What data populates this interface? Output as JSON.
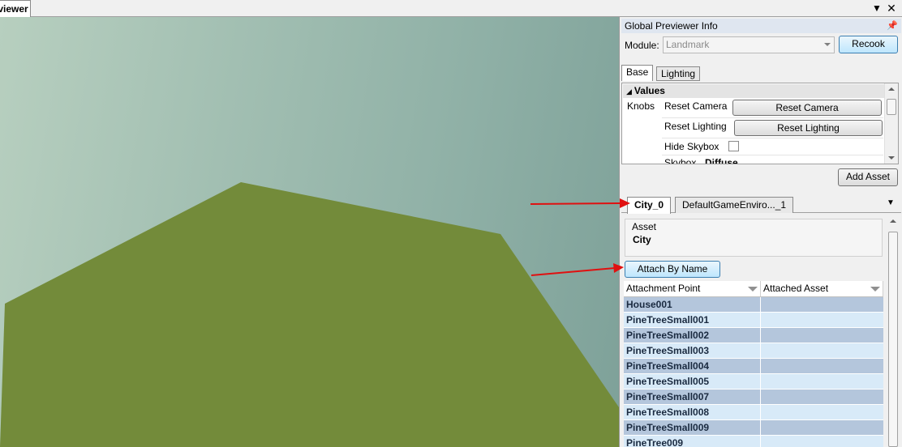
{
  "window": {
    "tab_label": "Previewer",
    "dropdown_icon": "chevron-down-icon",
    "close_icon": "close-icon"
  },
  "panel": {
    "title": "Global Previewer Info",
    "pin_icon": "pin-icon",
    "module_label": "Module:",
    "module_value": "Landmark",
    "recook_label": "Recook",
    "tabs": [
      "Base",
      "Lighting"
    ],
    "values_header": "Values",
    "knobs_label": "Knobs",
    "properties": [
      {
        "name": "Reset Camera",
        "button": "Reset Camera"
      },
      {
        "name": "Reset Lighting",
        "button": "Reset Lighting"
      },
      {
        "name": "Hide Skybox",
        "checked": false
      },
      {
        "name": "Skybox",
        "value": "Diffuse"
      }
    ],
    "add_asset_label": "Add Asset"
  },
  "asset_tabs": [
    "City_0",
    "DefaultGameEnviro..._1"
  ],
  "asset": {
    "group_label": "Asset",
    "name": "City",
    "attach_button": "Attach By Name"
  },
  "grid": {
    "columns": [
      "Attachment Point",
      "Attached Asset"
    ],
    "rows": [
      {
        "point": "House001",
        "asset": "",
        "shade": "dark"
      },
      {
        "point": "PineTreeSmall001",
        "asset": "",
        "shade": "light"
      },
      {
        "point": "PineTreeSmall002",
        "asset": "",
        "shade": "dark"
      },
      {
        "point": "PineTreeSmall003",
        "asset": "",
        "shade": "light"
      },
      {
        "point": "PineTreeSmall004",
        "asset": "",
        "shade": "dark"
      },
      {
        "point": "PineTreeSmall005",
        "asset": "",
        "shade": "light"
      },
      {
        "point": "PineTreeSmall007",
        "asset": "",
        "shade": "dark"
      },
      {
        "point": "PineTreeSmall008",
        "asset": "",
        "shade": "light"
      },
      {
        "point": "PineTreeSmall009",
        "asset": "",
        "shade": "dark"
      },
      {
        "point": "PineTree009",
        "asset": "",
        "shade": "light"
      }
    ]
  },
  "colors": {
    "terrain": "#738b3a",
    "annotation_arrow": "#e01010",
    "row_dark": "#b4c6dc",
    "row_light": "#d8eaf8"
  }
}
